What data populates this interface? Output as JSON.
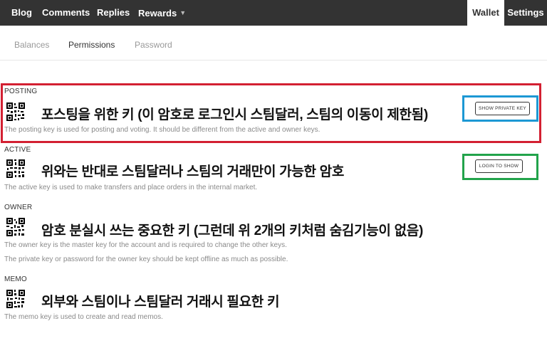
{
  "nav": {
    "blog": "Blog",
    "comments": "Comments",
    "replies": "Replies",
    "rewards": "Rewards",
    "wallet": "Wallet",
    "settings": "Settings"
  },
  "tabs": {
    "balances": "Balances",
    "permissions": "Permissions",
    "password": "Password"
  },
  "keys": {
    "posting": {
      "label": "POSTING",
      "note": "포스팅을 위한 키 (이 암호로 로그인시 스팀달러, 스팀의 이동이 제한됨)",
      "description": "The posting key is used for posting and voting. It should be different from the active and owner keys.",
      "button": "SHOW PRIVATE KEY"
    },
    "active": {
      "label": "ACTIVE",
      "note": "위와는 반대로 스팀달러나 스팀의 거래만이 가능한 암호",
      "description": "The active key is used to make transfers and place orders in the internal market.",
      "button": "LOGIN TO SHOW"
    },
    "owner": {
      "label": "OWNER",
      "note": "암호 분실시 쓰는 중요한 키 (그런데 위 2개의 키처럼 숨김기능이 없음)",
      "description_1": "The owner key is the master key for the account and is required to change the other keys.",
      "description_2": "The private key or password for the owner key should be kept offline as much as possible."
    },
    "memo": {
      "label": "MEMO",
      "note": "외부와 스팀이나 스팀달러 거래시 필요한 키",
      "description": "The memo key is used to create and read memos."
    }
  },
  "highlight_colors": {
    "posting_box": "#d32032",
    "show_key_box": "#1c98d4",
    "login_box": "#22a34b"
  }
}
